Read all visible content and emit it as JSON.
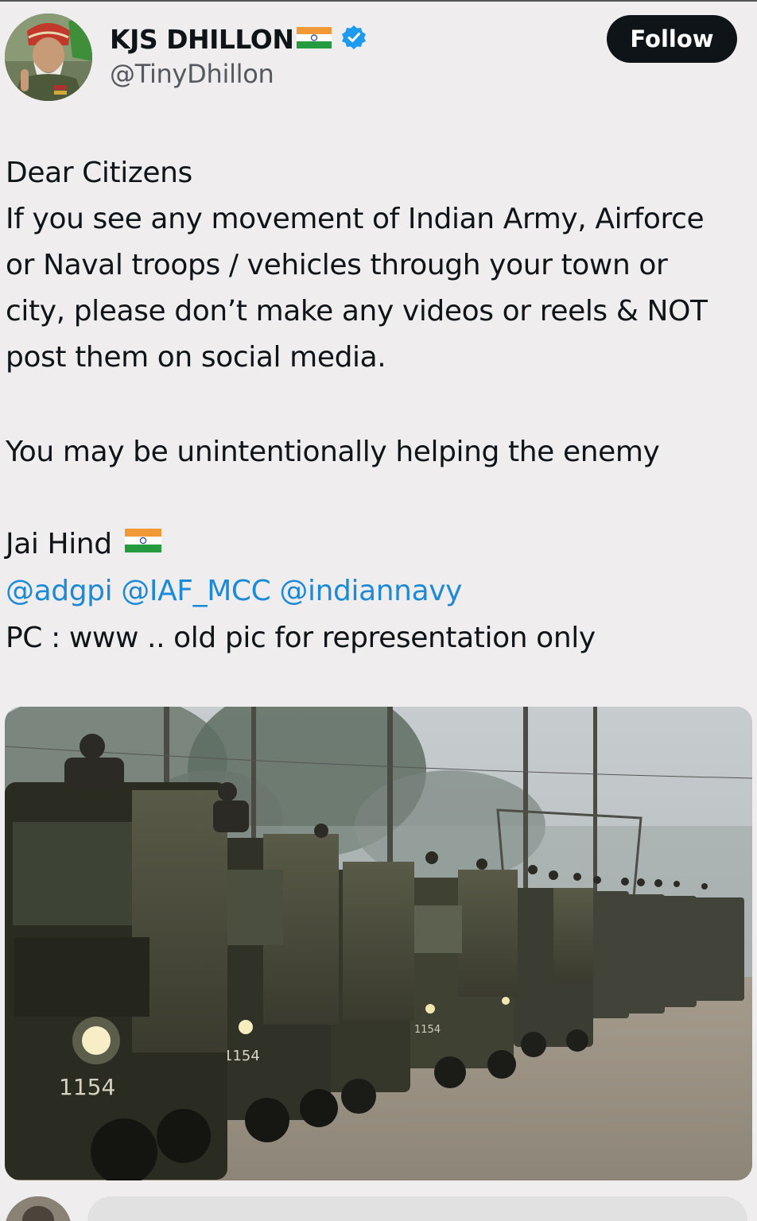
{
  "author": {
    "display_name": "KJS DHILLON",
    "handle": "@TinyDhillon"
  },
  "follow_label": "Follow",
  "tweet": {
    "line1": "Dear Citizens",
    "line2": "If you see any movement of Indian Army, Airforce",
    "line3": "or Naval troops / vehicles through your town or",
    "line4": "city, please don’t make any videos or reels & NOT",
    "line5": "post them on social media.",
    "line6": "You may be unintentionally helping the enemy",
    "jai_hind": "Jai Hind",
    "mentions": [
      "@adgpi",
      "@IAF_MCC",
      "@indiannavy"
    ],
    "pc_line": "PC : www .. old pic for representation only"
  },
  "media": {
    "truck_number_front": "1154",
    "truck_number_second": "1154",
    "truck_number_third": "1154"
  },
  "icons": {
    "verified": "verified-badge-icon",
    "flag": "india-flag-icon"
  },
  "colors": {
    "background": "#efeded",
    "text": "#0f1419",
    "secondary_text": "#54595f",
    "link": "#1d8ad8",
    "verified": "#1d9bf0",
    "button": "#0f1419"
  }
}
